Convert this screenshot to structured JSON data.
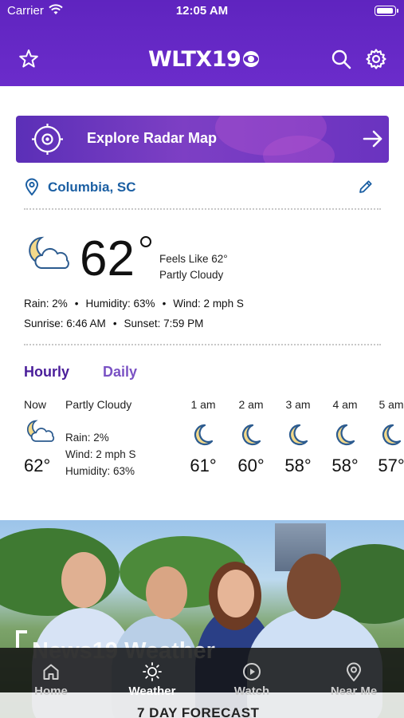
{
  "status_bar": {
    "carrier": "Carrier",
    "time": "12:05 AM",
    "battery_level": 0.95
  },
  "header": {
    "logo_text": "WLTX19",
    "favorite_icon": "star-icon",
    "search_icon": "search-icon",
    "settings_icon": "gear-icon"
  },
  "radar_banner": {
    "label": "Explore Radar Map",
    "icon": "radar-icon",
    "arrow_icon": "arrow-right-icon"
  },
  "location": {
    "name": "Columbia, SC",
    "pin_icon": "location-pin-icon",
    "edit_icon": "pencil-icon"
  },
  "current": {
    "temp": "62",
    "icon": "partly-cloudy-night-icon",
    "feels_like": "Feels Like 62°",
    "condition": "Partly Cloudy",
    "rain": "Rain: 2%",
    "humidity": "Humidity: 63%",
    "wind": "Wind: 2 mph S",
    "sunrise": "Sunrise: 6:46 AM",
    "sunset": "Sunset: 7:59 PM"
  },
  "forecast_tabs": {
    "hourly": "Hourly",
    "daily": "Daily"
  },
  "hourly": {
    "now_label": "Now",
    "now_condition": "Partly Cloudy",
    "now_rain": "Rain: 2%",
    "now_wind": "Wind: 2 mph S",
    "now_humidity": "Humidity: 63%",
    "now_temp": "62°",
    "hours": [
      {
        "time": "1 am",
        "temp": "61°",
        "icon": "moon-icon"
      },
      {
        "time": "2 am",
        "temp": "60°",
        "icon": "moon-icon"
      },
      {
        "time": "3 am",
        "temp": "58°",
        "icon": "moon-icon"
      },
      {
        "time": "4 am",
        "temp": "58°",
        "icon": "moon-icon"
      },
      {
        "time": "5 am",
        "temp": "57°",
        "icon": "moon-icon"
      }
    ]
  },
  "hero": {
    "title": "News19 Weather",
    "next_section": "7 DAY FORECAST"
  },
  "tabbar": {
    "items": [
      {
        "label": "Home",
        "icon": "home-icon"
      },
      {
        "label": "Weather",
        "icon": "sun-icon"
      },
      {
        "label": "Watch",
        "icon": "play-icon"
      },
      {
        "label": "Near Me",
        "icon": "location-pin-icon"
      }
    ],
    "active": "Weather"
  },
  "colors": {
    "brand_purple": "#6526c4",
    "link_blue": "#1b5fa3",
    "tab_active": "#4a1e9a"
  }
}
